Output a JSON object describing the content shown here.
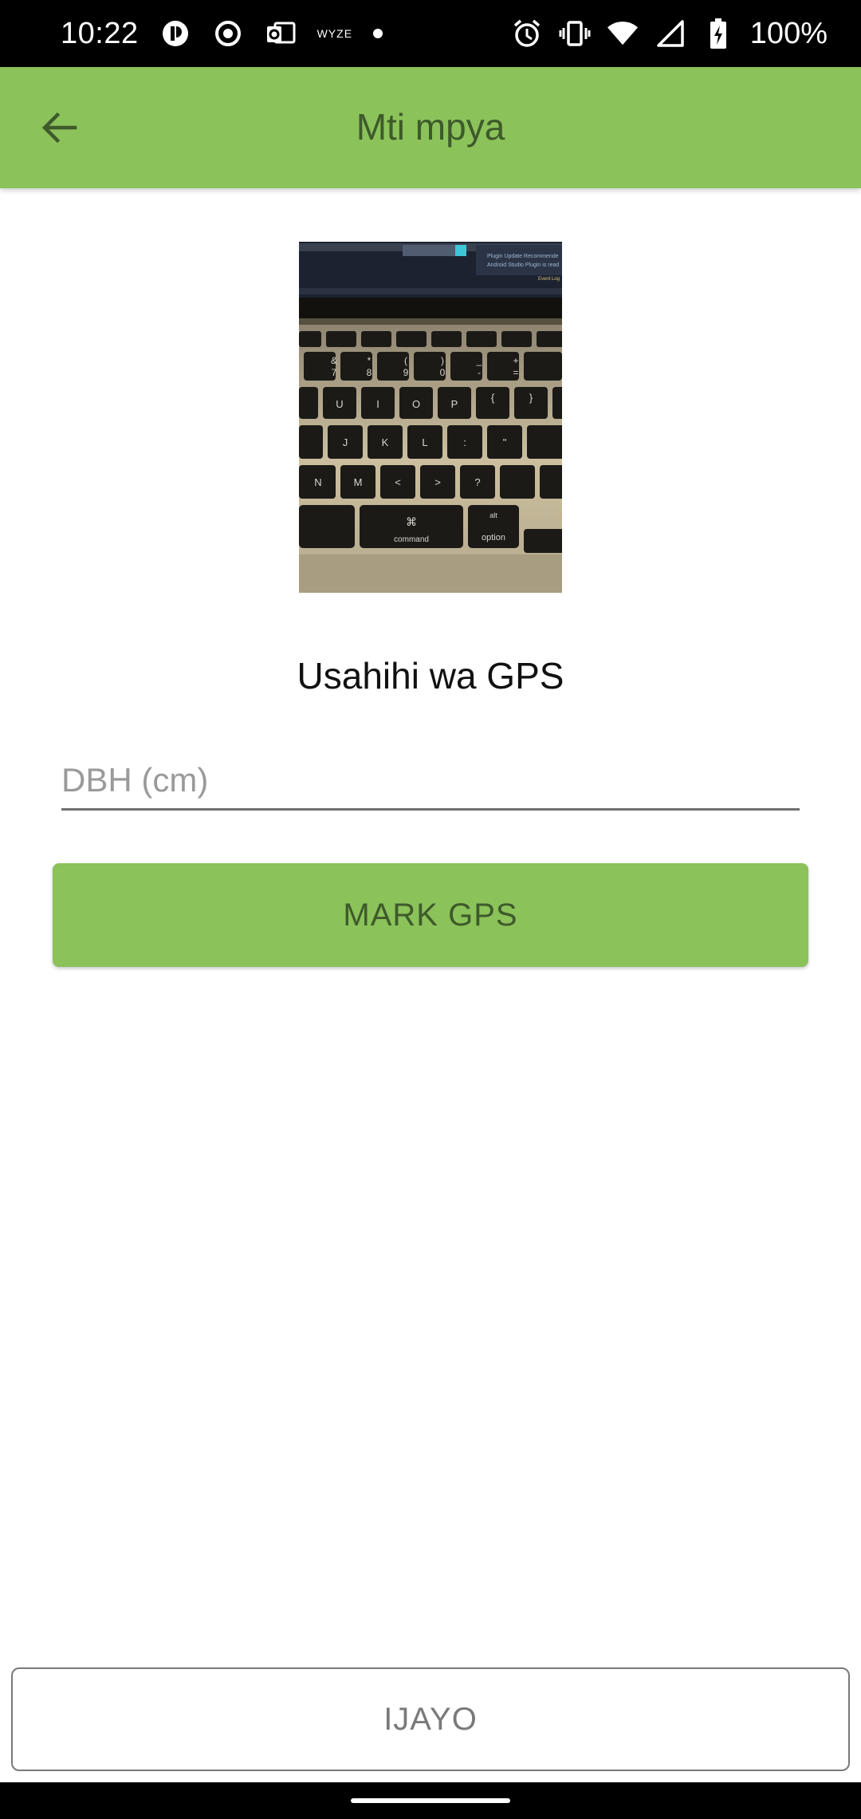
{
  "status_bar": {
    "time": "10:22",
    "wyze_label": "WYZE",
    "battery": "100%"
  },
  "app_bar": {
    "title": "Mti mpya",
    "back_icon": "arrow-back-icon",
    "color": "#8bc25a"
  },
  "photo": {
    "description_icon": "tree-photo",
    "keys": [
      "&",
      "*",
      "(",
      ")",
      "_",
      "+",
      "7",
      "8",
      "9",
      "0",
      "-",
      "=",
      "U",
      "I",
      "O",
      "P",
      "{",
      "}",
      "J",
      "K",
      "L",
      ":",
      "\"",
      "N",
      "M",
      "<",
      ">",
      "?",
      "⌘"
    ],
    "key_labels": {
      "command": "command",
      "option": "option",
      "alt": "alt"
    },
    "screen_texts": [
      "Plugin Update Recommende",
      "Android Studio Plugin is read",
      "Event Log"
    ]
  },
  "gps_accuracy_label": "Usahihi wa GPS",
  "dbh_input": {
    "value": "",
    "placeholder": "DBH (cm)"
  },
  "mark_gps_button": "MARK GPS",
  "next_button": "IJAYO"
}
